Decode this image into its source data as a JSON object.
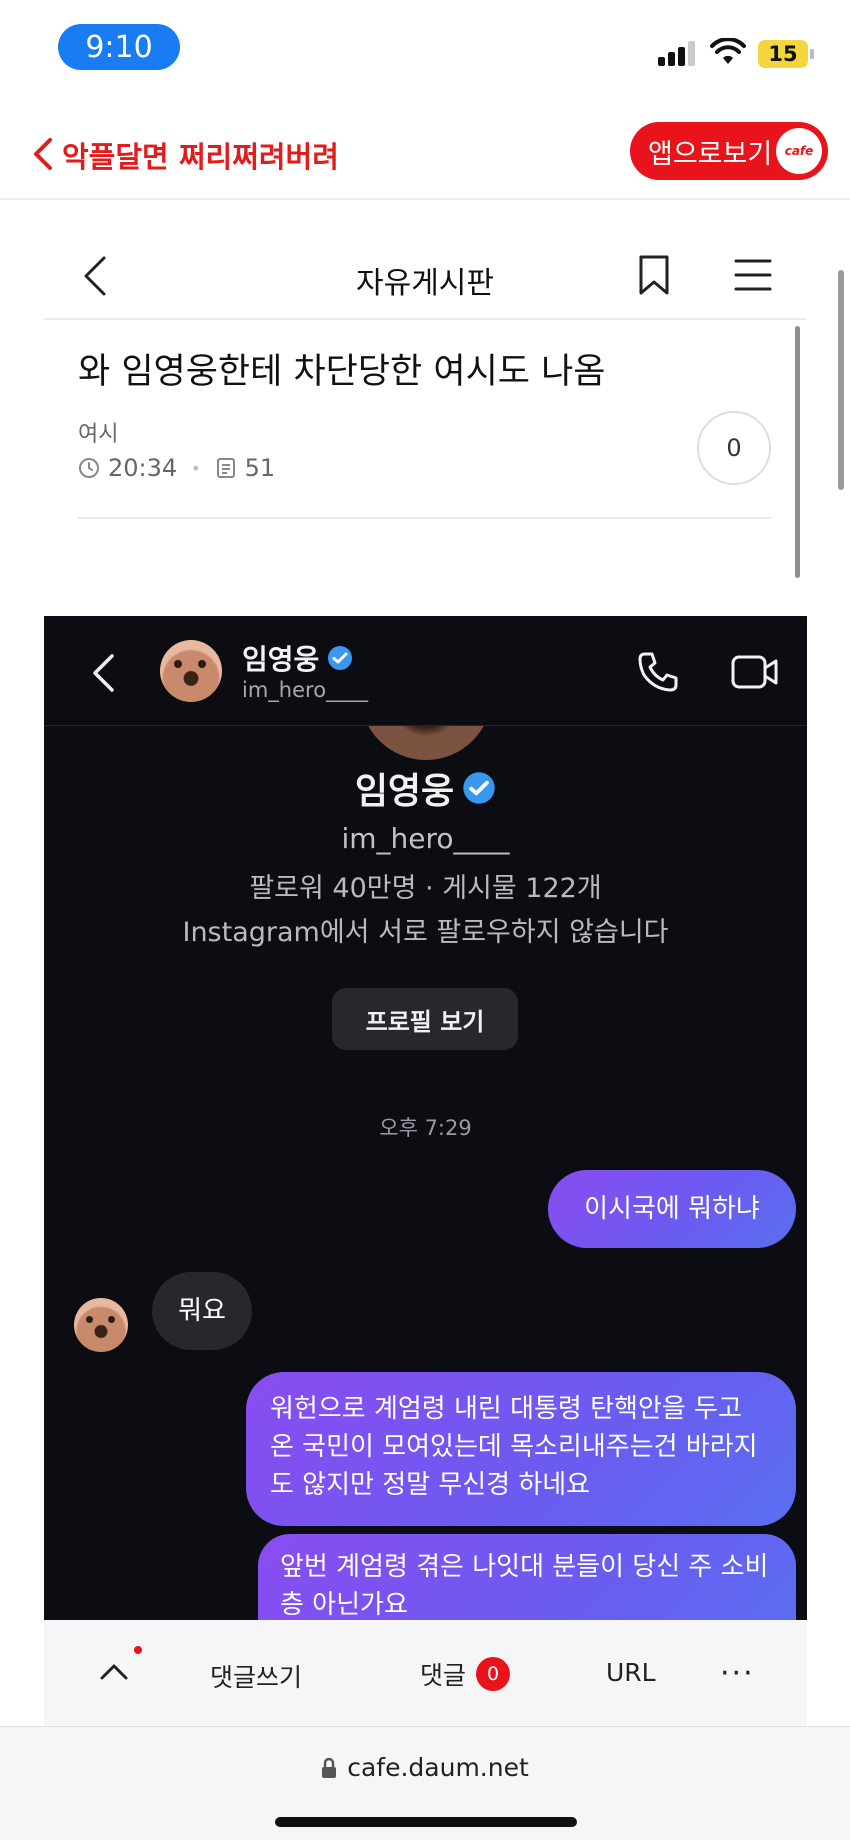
{
  "status_bar": {
    "time": "9:10",
    "battery": "15"
  },
  "cafe_header": {
    "title": "악플달면 쩌리쩌려버려",
    "app_button": "앱으로보기",
    "badge": "cafe"
  },
  "board": {
    "title": "자유게시판"
  },
  "post": {
    "title": "와 임영웅한테 차단당한 여시도 나옴",
    "author": "여시",
    "time": "20:34",
    "views": "51",
    "comment_count": "0"
  },
  "instagram": {
    "name": "임영웅",
    "handle": "im_hero____",
    "profile_name": "임영웅",
    "profile_handle": "im_hero____",
    "stats": "팔로워 40만명 · 게시물 122개",
    "note": "Instagram에서 서로 팔로우하지 않습니다",
    "profile_button": "프로필 보기",
    "chat_time": "오후 7:29",
    "messages": {
      "m1": "이시국에 뭐하냐",
      "m2": "뭐요",
      "m3": "워헌으로 계엄령 내린 대통령 탄핵안을 두고 온 국민이 모여있는데 목소리내주는건 바라지도 않지만 정말 무신경 하네요",
      "m4": "앞번 계엄령 겪은 나잇대 분들이 당신 주 소비층 아닌가요"
    },
    "accent_color": "#3897f0"
  },
  "action_bar": {
    "write": "댓글쓰기",
    "comment": "댓글",
    "comment_count": "0",
    "url": "URL",
    "more": "···"
  },
  "browser": {
    "url": "cafe.daum.net"
  },
  "colors": {
    "brand_red": "#e8131b",
    "time_pill": "#1a7cf2",
    "bubble_sent": "#7a55f0"
  }
}
